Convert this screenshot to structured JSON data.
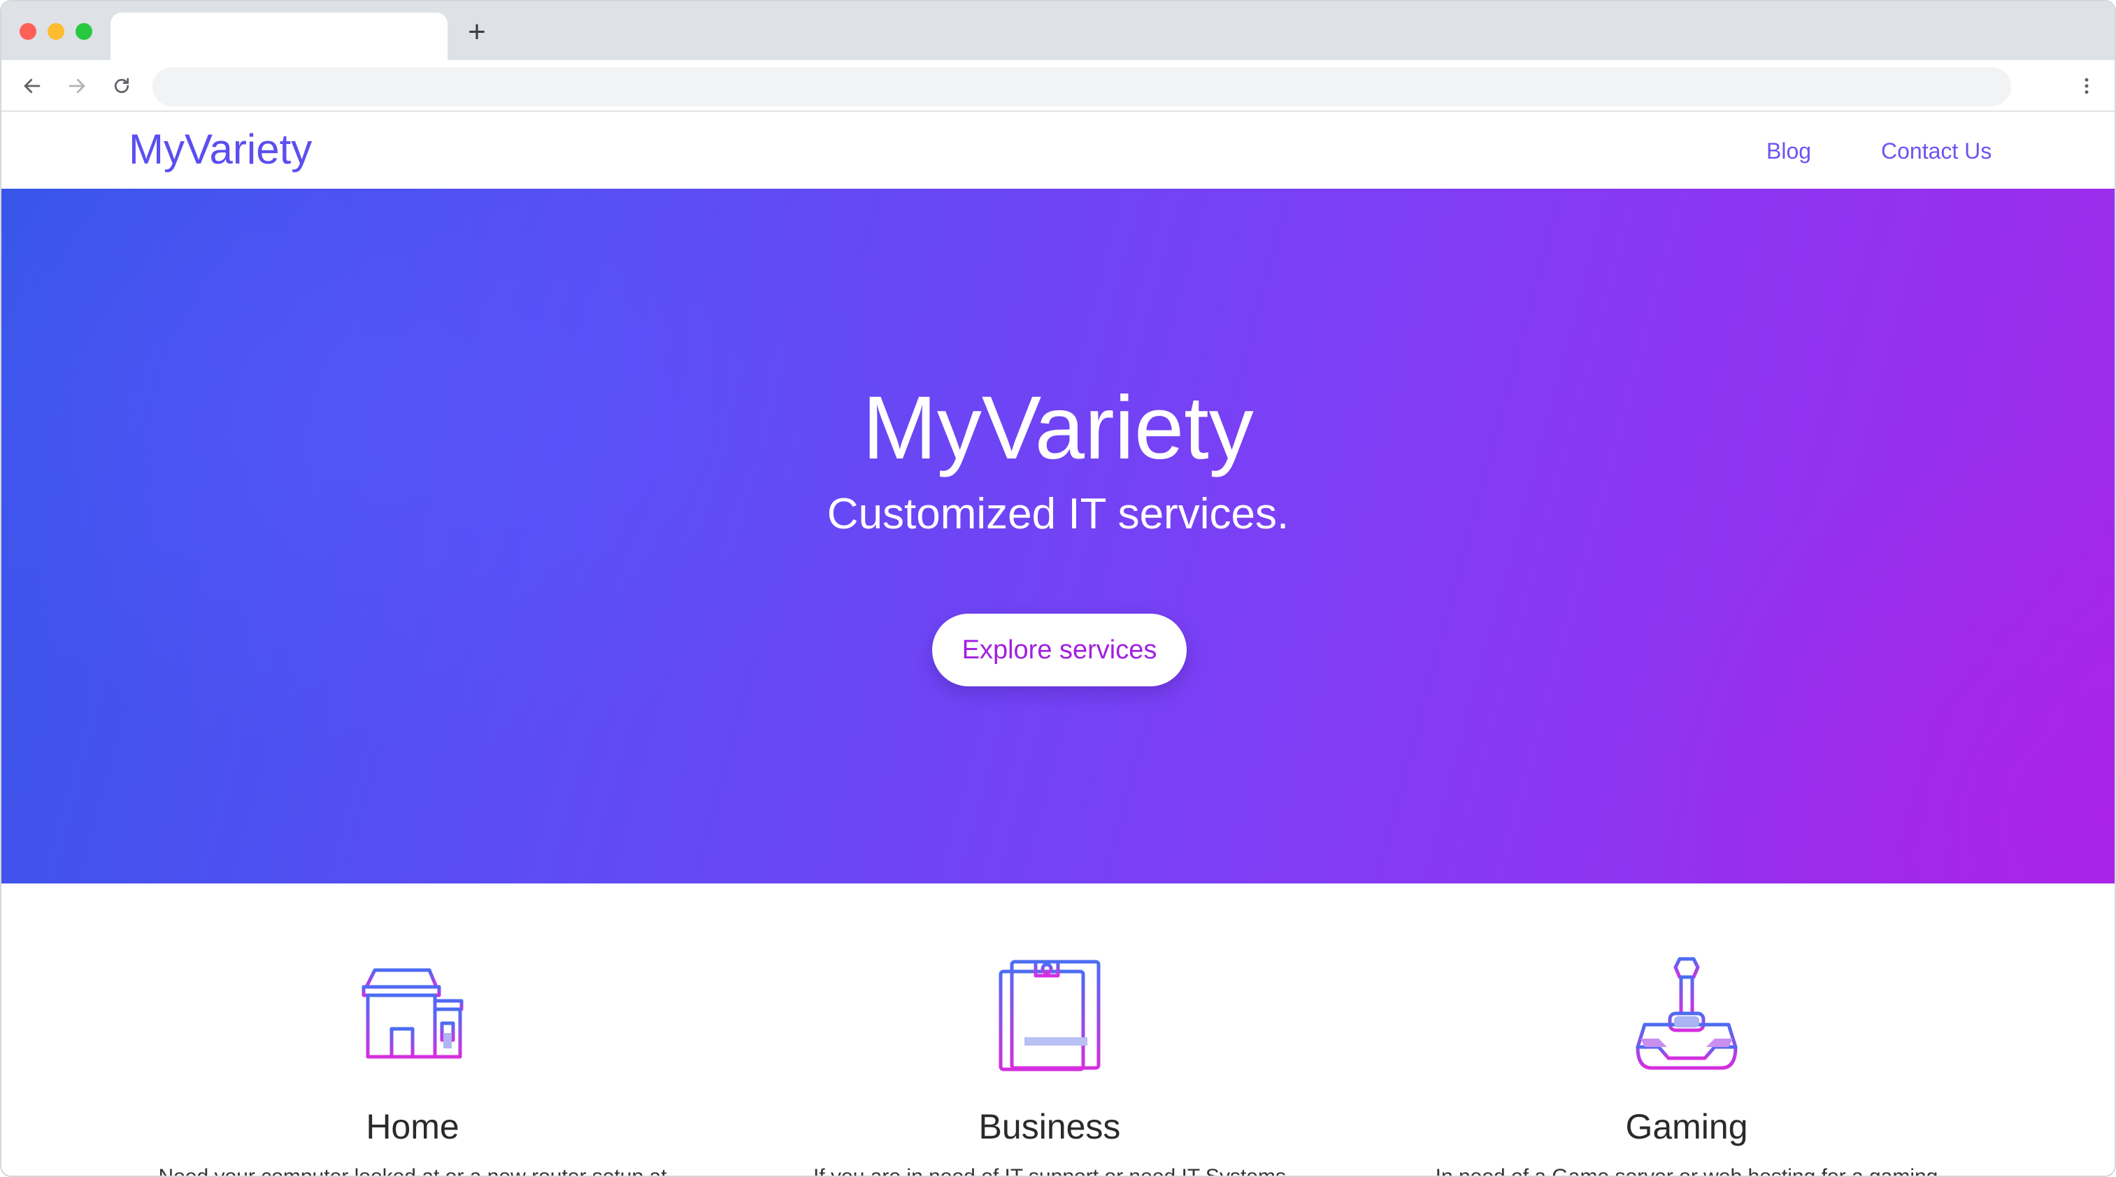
{
  "browser": {
    "tab_title": "",
    "new_tab_label": "+",
    "address_bar_value": "",
    "icons": {
      "back": "arrow-left-icon",
      "forward": "arrow-right-icon",
      "reload": "reload-icon",
      "menu": "more-vert-icon"
    }
  },
  "site_nav": {
    "brand": "MyVariety",
    "links": [
      {
        "label": "Blog"
      },
      {
        "label": "Contact Us"
      }
    ]
  },
  "hero": {
    "title": "MyVariety",
    "subtitle": "Customized IT services.",
    "cta_label": "Explore services"
  },
  "services": [
    {
      "icon": "house-icon",
      "title": "Home",
      "description": "Need your computer looked at or a new router setup at"
    },
    {
      "icon": "clipboard-icon",
      "title": "Business",
      "description": "If you are in need of IT support or need IT Systems"
    },
    {
      "icon": "joystick-icon",
      "title": "Gaming",
      "description": "In need of a Game server or web hosting for a gaming"
    }
  ],
  "colors": {
    "brand": "#5b4ef0",
    "nav_link": "#6a55f0",
    "hero_gradient_start": "#3656e8",
    "hero_gradient_end": "#a328ea",
    "cta_text": "#a21fe0"
  }
}
